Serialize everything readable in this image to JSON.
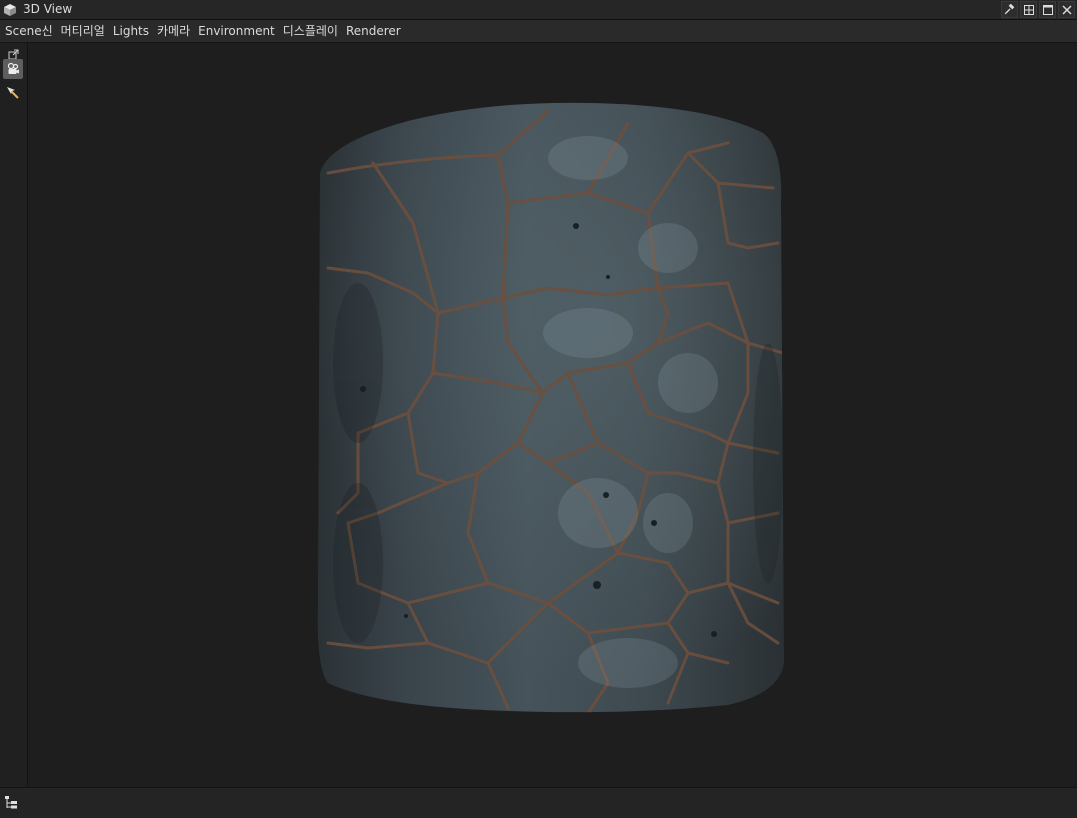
{
  "window": {
    "title": "3D View",
    "icon": "cube-icon",
    "buttons": [
      "pin-icon",
      "tile-icon",
      "maximize-icon",
      "close-icon"
    ]
  },
  "menu": {
    "items": [
      {
        "label": "Scene신"
      },
      {
        "label": "머티리얼"
      },
      {
        "label": "Lights"
      },
      {
        "label": "카메라"
      },
      {
        "label": "Environment"
      },
      {
        "label": "디스플레이"
      },
      {
        "label": "Renderer"
      }
    ]
  },
  "toolbar": {
    "tools": [
      {
        "name": "detach-icon"
      },
      {
        "name": "camera-orbit-icon",
        "active": true
      },
      {
        "name": "pick-arrow-icon"
      }
    ]
  },
  "viewport": {
    "object": "stone-tile-cylinder",
    "colors": {
      "background": "#1e1e1e",
      "stone": "#3c474c",
      "grout": "#6d4f3d"
    }
  },
  "status": {
    "icon": "scene-tree-icon"
  }
}
